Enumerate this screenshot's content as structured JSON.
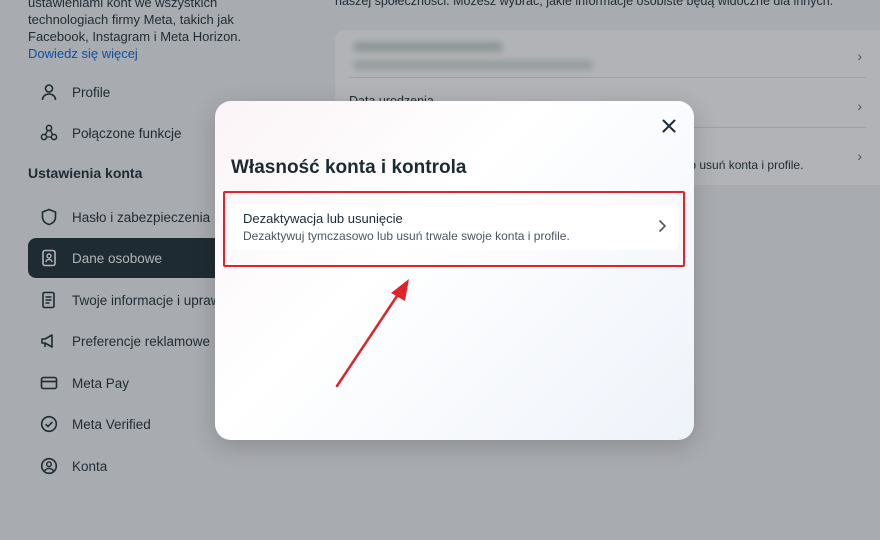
{
  "sidebar": {
    "intro_text": "ustawieniami kont we wszystkich technologiach firmy Meta, takich jak Facebook, Instagram i Meta Horizon.",
    "intro_link": "Dowiedz się więcej",
    "items_top": [
      {
        "label": "Profile",
        "icon": "person-icon"
      },
      {
        "label": "Połączone funkcje",
        "icon": "connected-icon"
      }
    ],
    "section_title": "Ustawienia konta",
    "items": [
      {
        "label": "Hasło i zabezpieczenia",
        "icon": "shield-icon"
      },
      {
        "label": "Dane osobowe",
        "icon": "id-card-icon",
        "active": true
      },
      {
        "label": "Twoje informacje i uprawnienia",
        "icon": "document-icon"
      },
      {
        "label": "Preferencje reklamowe",
        "icon": "megaphone-icon"
      },
      {
        "label": "Meta Pay",
        "icon": "card-icon"
      },
      {
        "label": "Meta Verified",
        "icon": "verified-icon"
      },
      {
        "label": "Konta",
        "icon": "account-circle-icon"
      }
    ]
  },
  "main": {
    "intro_text": "naszej społeczności. Możesz wybrać, jakie informacje osobiste będą widoczne dla innych.",
    "row_birthdate": "Data urodzenia",
    "row_sub": "lub usuń konta i profile."
  },
  "modal": {
    "title": "Własność konta i kontrola",
    "option_title": "Dezaktywacja lub usunięcie",
    "option_desc": "Dezaktywuj tymczasowo lub usuń trwale swoje konta i profile."
  },
  "colors": {
    "highlight": "#e0222d",
    "link": "#0064e0",
    "active_nav": "#1c2b33"
  }
}
